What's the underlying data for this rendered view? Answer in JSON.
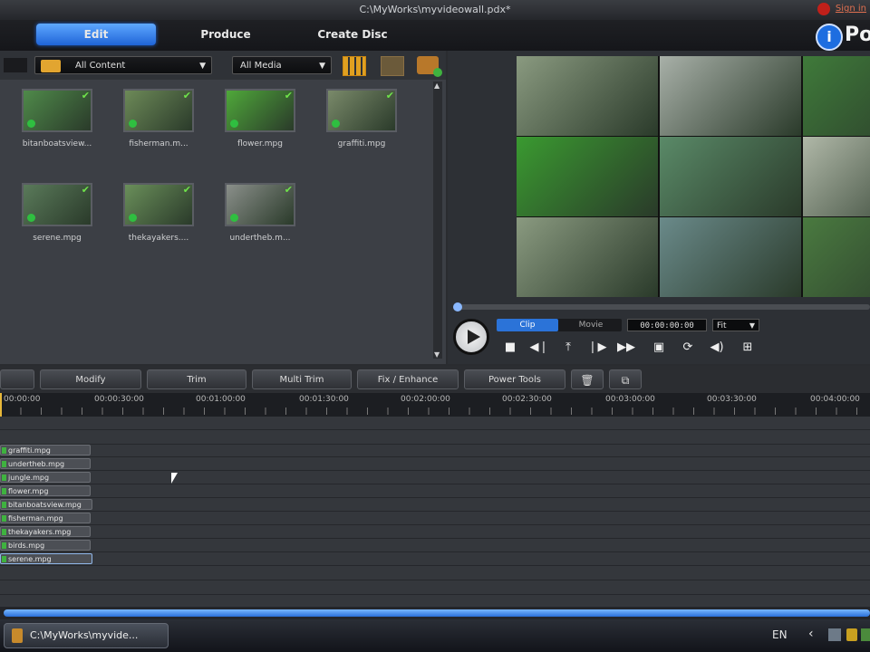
{
  "window": {
    "title": "C:\\MyWorks\\myvideowall.pdx*",
    "signin": "Sign in"
  },
  "tabs": [
    {
      "label": "Edit",
      "active": true
    },
    {
      "label": "Produce",
      "active": false
    },
    {
      "label": "Create Disc",
      "active": false
    }
  ],
  "brand": {
    "logo_text": "Po"
  },
  "library": {
    "content_filter": "All Content",
    "media_filter": "All Media",
    "items": [
      {
        "name": "bitanboatsview...",
        "color": "#4f8a4a"
      },
      {
        "name": "fisherman.m...",
        "color": "#6d8a58"
      },
      {
        "name": "flower.mpg",
        "color": "#4fa83a"
      },
      {
        "name": "graffiti.mpg",
        "color": "#7a8a6a"
      },
      {
        "name": "serene.mpg",
        "color": "#5a7a5a"
      },
      {
        "name": "thekayakers....",
        "color": "#6a8f5a"
      },
      {
        "name": "undertheb.m...",
        "color": "#8a8f8a"
      }
    ]
  },
  "preview": {
    "mode_clip": "Clip",
    "mode_movie": "Movie",
    "timecode": "00:00:00:00",
    "zoom": "Fit",
    "video_colors": [
      "#8a9a80",
      "#a8b0a8",
      "#3f7a3a",
      "#3a9a30",
      "#5a8a68",
      "#b0b8a8",
      "#8a9a80",
      "#6a8a8a",
      "#4a7a40"
    ],
    "controls": [
      "stop",
      "prev-frame",
      "snapshot",
      "next-frame",
      "fast-forward",
      "fullscreen",
      "repeat",
      "volume",
      "more"
    ]
  },
  "edit_tools": {
    "buttons": [
      "Modify",
      "Trim",
      "Multi Trim",
      "Fix / Enhance",
      "Power Tools"
    ]
  },
  "ruler": {
    "labels": [
      "00:00:00",
      "00:00:30:00",
      "00:01:00:00",
      "00:01:30:00",
      "00:02:00:00",
      "00:02:30:00",
      "00:03:00:00",
      "00:03:30:00",
      "00:04:00:00"
    ]
  },
  "timeline": {
    "clips": [
      "graffiti.mpg",
      "undertheb.mpg",
      "jungle.mpg",
      "flower.mpg",
      "bitanboatsview.mpg",
      "fisherman.mpg",
      "thekayakers.mpg",
      "birds.mpg",
      "serene.mpg"
    ],
    "selected_clip": "serene.mpg"
  },
  "taskbar": {
    "window_label": "C:\\MyWorks\\myvide...",
    "language": "EN"
  },
  "colors": {
    "accent": "#2b73d8",
    "panel": "#3c3f45",
    "check": "#6fe34a"
  }
}
